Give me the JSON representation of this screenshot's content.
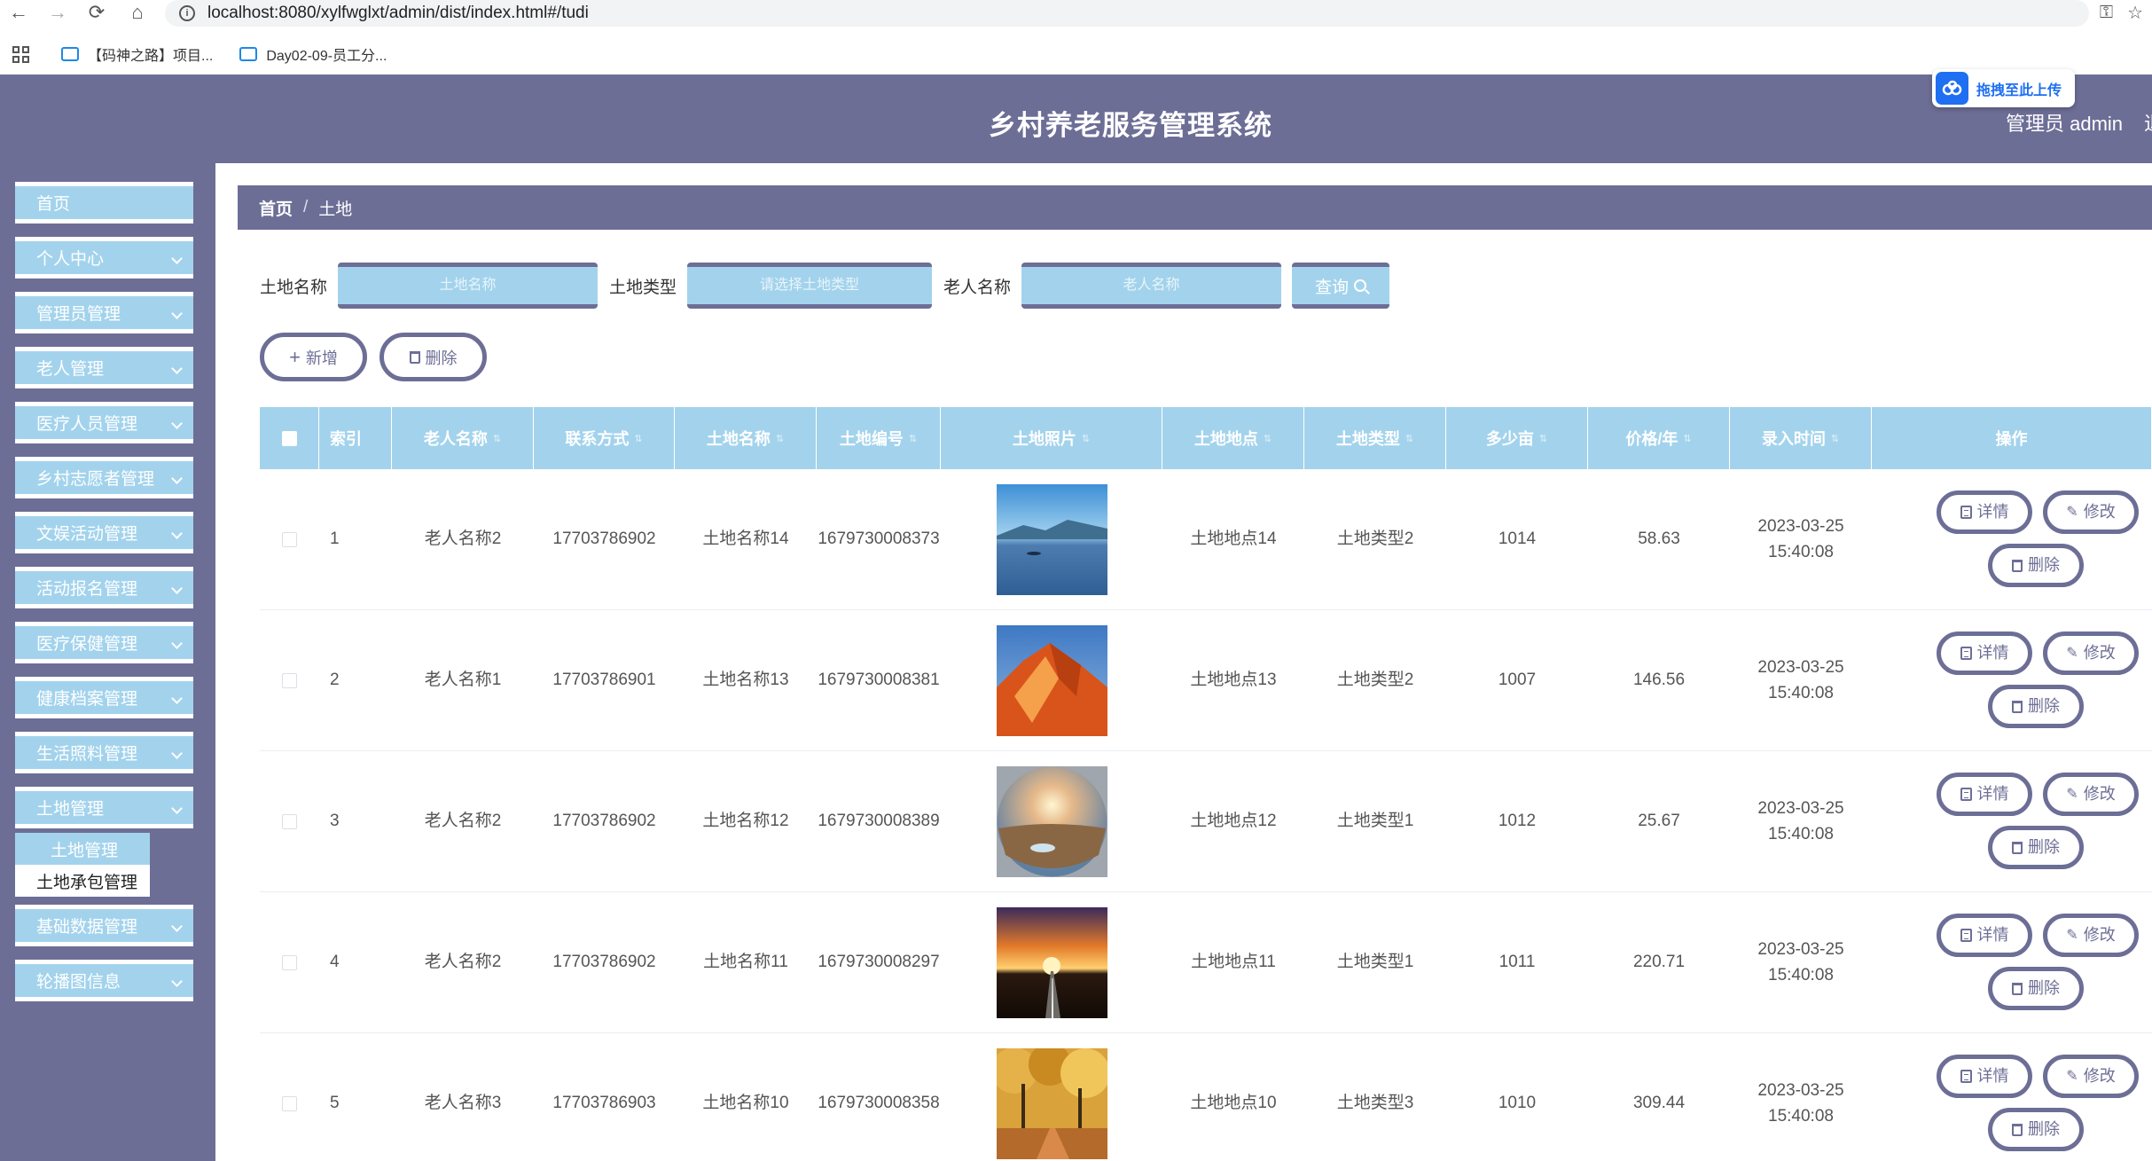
{
  "browser": {
    "url": "localhost:8080/xylfwglxt/admin/dist/index.html#/tudi",
    "bookmarks": [
      "【码神之路】项目...",
      "Day02-09-员工分..."
    ]
  },
  "header": {
    "title": "乡村养老服务管理系统",
    "admin_label": "管理员 admin",
    "logout_label": "退",
    "upload_label": "拖拽至此上传"
  },
  "sidebar": {
    "items": [
      {
        "label": "首页",
        "has_children": false
      },
      {
        "label": "个人中心",
        "has_children": true
      },
      {
        "label": "管理员管理",
        "has_children": true
      },
      {
        "label": "老人管理",
        "has_children": true
      },
      {
        "label": "医疗人员管理",
        "has_children": true
      },
      {
        "label": "乡村志愿者管理",
        "has_children": true
      },
      {
        "label": "文娱活动管理",
        "has_children": true
      },
      {
        "label": "活动报名管理",
        "has_children": true
      },
      {
        "label": "医疗保健管理",
        "has_children": true
      },
      {
        "label": "健康档案管理",
        "has_children": true
      },
      {
        "label": "生活照料管理",
        "has_children": true
      },
      {
        "label": "土地管理",
        "has_children": true
      },
      {
        "label": "基础数据管理",
        "has_children": true
      },
      {
        "label": "轮播图信息",
        "has_children": true
      }
    ],
    "submenu": [
      "土地管理",
      "土地承包管理"
    ]
  },
  "breadcrumb": {
    "home": "首页",
    "sep": "/",
    "current": "土地"
  },
  "search": {
    "land_name_label": "土地名称",
    "land_name_placeholder": "土地名称",
    "land_type_label": "土地类型",
    "land_type_placeholder": "请选择土地类型",
    "elder_name_label": "老人名称",
    "elder_name_placeholder": "老人名称",
    "query_label": "查询"
  },
  "toolbar": {
    "add_label": "新增",
    "delete_label": "删除"
  },
  "table": {
    "columns": [
      "索引",
      "老人名称",
      "联系方式",
      "土地名称",
      "土地编号",
      "土地照片",
      "土地地点",
      "土地类型",
      "多少亩",
      "价格/年",
      "录入时间",
      "操作"
    ],
    "actions": {
      "detail": "详情",
      "edit": "修改",
      "delete": "删除"
    },
    "rows": [
      {
        "index": "1",
        "elder": "老人名称2",
        "phone": "17703786902",
        "land_name": "土地名称14",
        "land_no": "1679730008373",
        "photo": "lake",
        "location": "土地地点14",
        "type": "土地类型2",
        "mu": "1014",
        "price": "58.63",
        "time": "2023-03-25 15:40:08"
      },
      {
        "index": "2",
        "elder": "老人名称1",
        "phone": "17703786901",
        "land_name": "土地名称13",
        "land_no": "1679730008381",
        "photo": "orange-rock",
        "location": "土地地点13",
        "type": "土地类型2",
        "mu": "1007",
        "price": "146.56",
        "time": "2023-03-25 15:40:08"
      },
      {
        "index": "3",
        "elder": "老人名称2",
        "phone": "17703786902",
        "land_name": "土地名称12",
        "land_no": "1679730008389",
        "photo": "desert-sunset",
        "location": "土地地点12",
        "type": "土地类型1",
        "mu": "1012",
        "price": "25.67",
        "time": "2023-03-25 15:40:08"
      },
      {
        "index": "4",
        "elder": "老人名称2",
        "phone": "17703786902",
        "land_name": "土地名称11",
        "land_no": "1679730008297",
        "photo": "road-sunset",
        "location": "土地地点11",
        "type": "土地类型1",
        "mu": "1011",
        "price": "220.71",
        "time": "2023-03-25 15:40:08"
      },
      {
        "index": "5",
        "elder": "老人名称3",
        "phone": "17703786903",
        "land_name": "土地名称10",
        "land_no": "1679730008358",
        "photo": "autumn-trees",
        "location": "土地地点10",
        "type": "土地类型3",
        "mu": "1010",
        "price": "309.44",
        "time": "2023-03-25 15:40:08"
      }
    ]
  },
  "colors": {
    "primary": "#6d6e96",
    "accent": "#a3d3ec"
  }
}
